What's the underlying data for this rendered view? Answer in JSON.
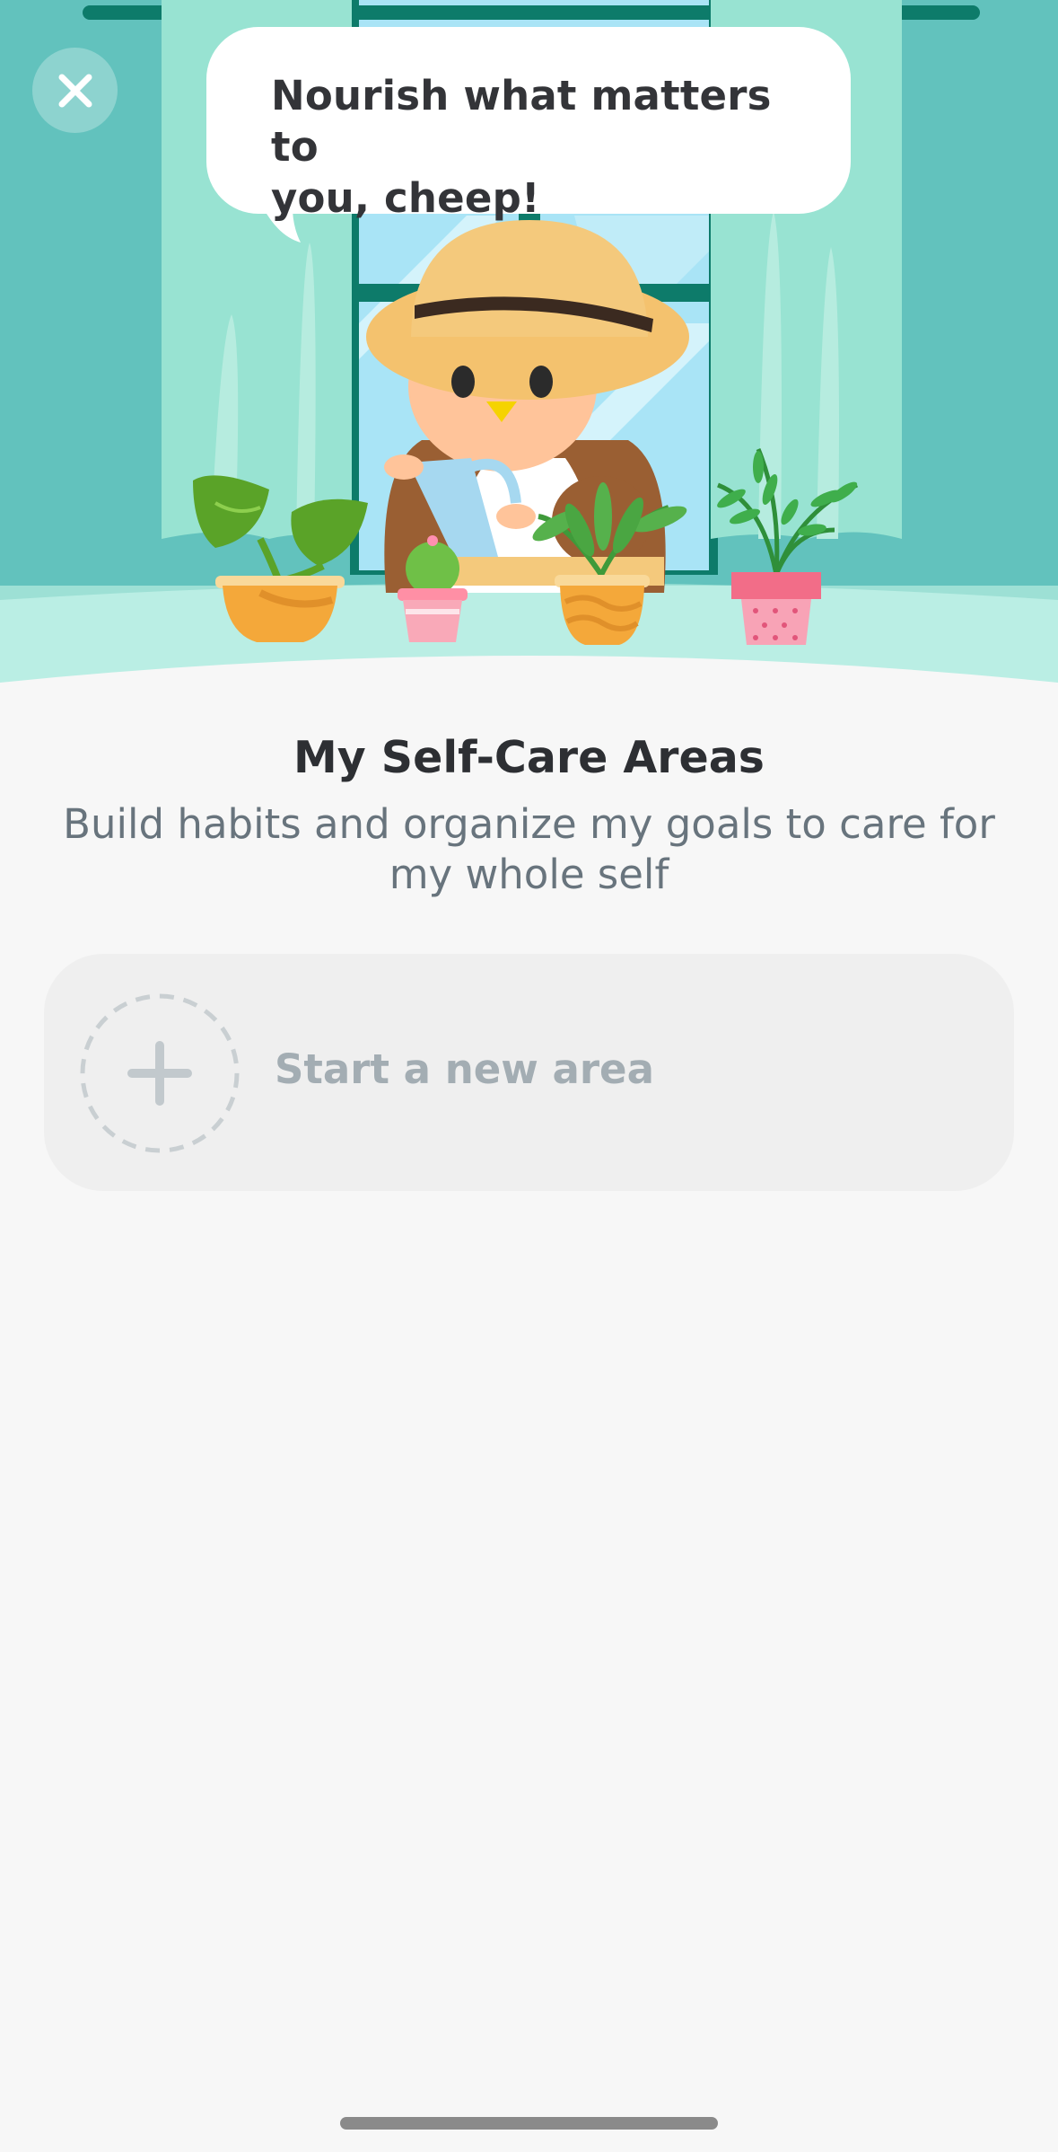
{
  "header": {
    "bubble_line1": "Nourish what matters to",
    "bubble_line2": "you, cheep!",
    "close_icon": "close-icon"
  },
  "main": {
    "title": "My Self-Care Areas",
    "subtitle": "Build habits and organize my goals to care for my whole self",
    "new_area_label": "Start a new area",
    "new_area_icon": "plus-icon"
  },
  "colors": {
    "wall": "#62c2bd",
    "curtain": "#98e3d2",
    "window_frame": "#0d7b6a",
    "sky": "#a7e2f5",
    "background": "#f7f7f7"
  }
}
